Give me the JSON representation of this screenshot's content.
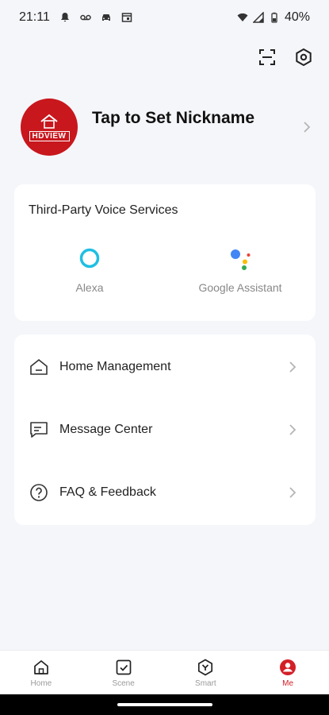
{
  "status_bar": {
    "time": "21:11",
    "battery": "40%",
    "icons_left": [
      "bell-icon",
      "voicemail-icon",
      "car-icon",
      "calendar-icon"
    ],
    "icons_right": [
      "wifi-icon",
      "signal-icon",
      "battery-icon"
    ]
  },
  "header": {
    "actions": [
      "scan-icon",
      "settings-icon"
    ]
  },
  "profile": {
    "nickname": "Tap to Set Nickname",
    "avatar_brand": "HDVIEW",
    "avatar_color": "#c8171d"
  },
  "voice_services": {
    "title": "Third-Party Voice Services",
    "items": [
      {
        "label": "Alexa",
        "icon": "alexa-icon"
      },
      {
        "label": "Google Assistant",
        "icon": "google-assistant-icon"
      }
    ]
  },
  "menu": {
    "items": [
      {
        "label": "Home Management",
        "icon": "home-outline-icon"
      },
      {
        "label": "Message Center",
        "icon": "message-icon"
      },
      {
        "label": "FAQ & Feedback",
        "icon": "help-icon"
      }
    ]
  },
  "tabbar": {
    "items": [
      {
        "label": "Home",
        "icon": "home-tab-icon",
        "active": false
      },
      {
        "label": "Scene",
        "icon": "scene-tab-icon",
        "active": false
      },
      {
        "label": "Smart",
        "icon": "smart-tab-icon",
        "active": false
      },
      {
        "label": "Me",
        "icon": "me-tab-icon",
        "active": true
      }
    ],
    "accent_color": "#d32027"
  }
}
